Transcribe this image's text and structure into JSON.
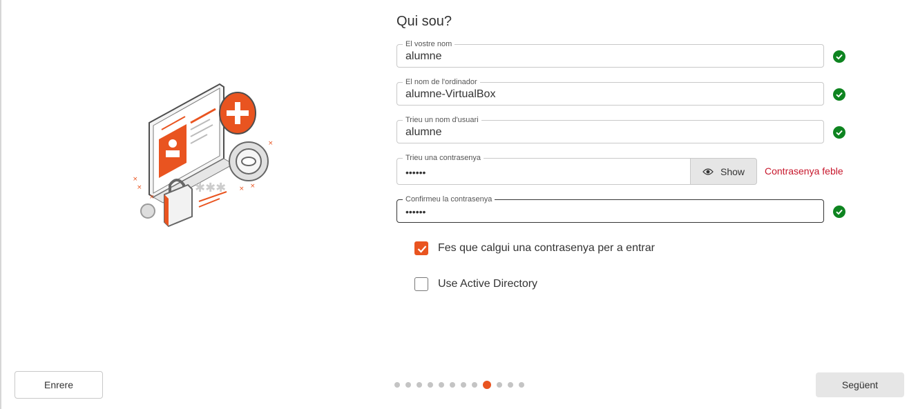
{
  "page": {
    "title": "Qui sou?"
  },
  "fields": {
    "name": {
      "label": "El vostre nom",
      "value": "alumne",
      "valid": true
    },
    "computer": {
      "label": "El nom de l'ordinador",
      "value": "alumne-VirtualBox",
      "valid": true
    },
    "username": {
      "label": "Trieu un nom d'usuari",
      "value": "alumne",
      "valid": true
    },
    "password": {
      "label": "Trieu una contrasenya",
      "value": "••••••",
      "show_label": "Show",
      "strength": "Contrasenya feble"
    },
    "confirm": {
      "label": "Confirmeu la contrasenya",
      "value": "••••••",
      "valid": true
    }
  },
  "options": {
    "require_password": {
      "label": "Fes que calgui una contrasenya per a entrar",
      "checked": true
    },
    "active_directory": {
      "label": "Use Active Directory",
      "checked": false
    }
  },
  "navigation": {
    "back_label": "Enrere",
    "next_label": "Següent",
    "steps_total": 12,
    "current_step": 9
  },
  "colors": {
    "accent": "#e95420",
    "valid": "#0e8420",
    "error": "#c7162b"
  },
  "icons": {
    "valid": "check-circle-icon",
    "show": "eye-icon",
    "checkbox": "checkmark-icon"
  }
}
